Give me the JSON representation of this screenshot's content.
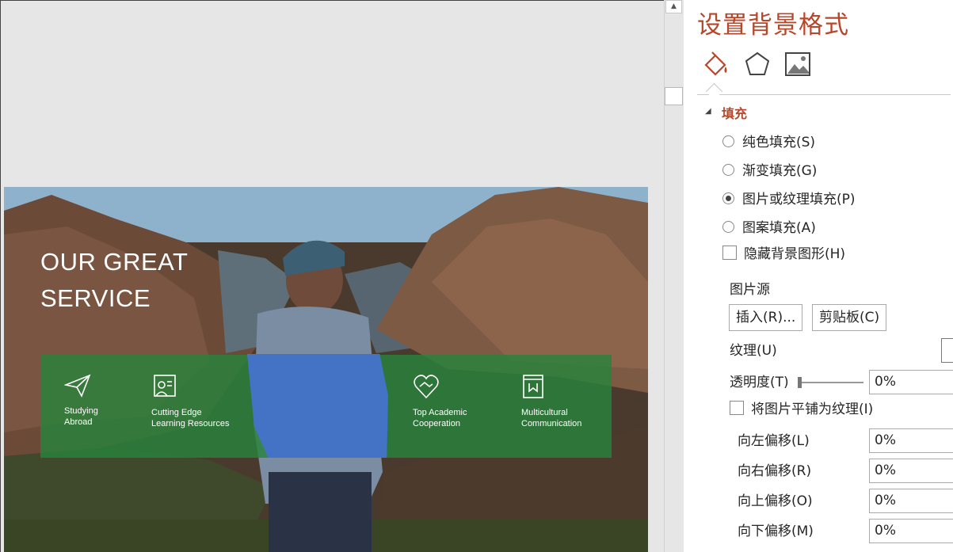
{
  "slide": {
    "title_line1": "OUR GREAT",
    "title_line2": "SERVICE",
    "services": [
      {
        "line1": "Studying",
        "line2": "Abroad",
        "icon": "paper-plane-icon"
      },
      {
        "line1": "Cutting Edge",
        "line2": "Learning Resources",
        "icon": "teacher-board-icon"
      },
      {
        "line1": "Top Academic",
        "line2": "Cooperation",
        "icon": "heart-handshake-icon"
      },
      {
        "line1": "Multicultural",
        "line2": "Communication",
        "icon": "book-icon"
      }
    ],
    "band_color": "#2e8b3e",
    "overlay_color": "#4472c4"
  },
  "pane": {
    "title": "设置背景格式",
    "tabs": [
      "fill-bucket-icon",
      "pentagon-icon",
      "picture-icon"
    ],
    "section": "填充",
    "options": [
      {
        "label": "纯色填充(S)",
        "selected": false
      },
      {
        "label": "渐变填充(G)",
        "selected": false
      },
      {
        "label": "图片或纹理填充(P)",
        "selected": true
      },
      {
        "label": "图案填充(A)",
        "selected": false
      }
    ],
    "hide_bg": "隐藏背景图形(H)",
    "picture_source": "图片源",
    "insert_button": "插入(R)...",
    "clipboard_button": "剪贴板(C)",
    "texture": "纹理(U)",
    "transparency_label": "透明度(T)",
    "transparency_value": "0%",
    "tile_label": "将图片平铺为纹理(I)",
    "offsets": [
      {
        "label": "向左偏移(L)",
        "value": "0%"
      },
      {
        "label": "向右偏移(R)",
        "value": "0%"
      },
      {
        "label": "向上偏移(O)",
        "value": "0%"
      },
      {
        "label": "向下偏移(M)",
        "value": "0%"
      }
    ],
    "accent_color": "#b7472a"
  }
}
